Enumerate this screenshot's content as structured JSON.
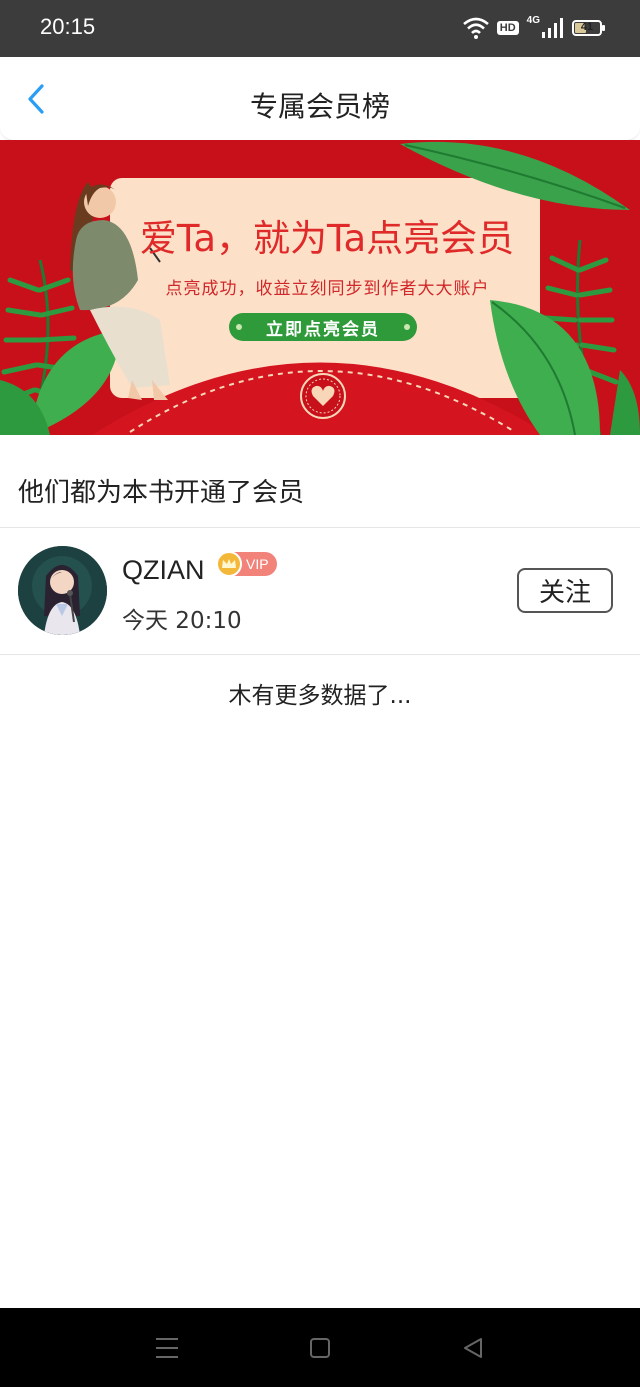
{
  "status_bar": {
    "time": "20:15",
    "hd_label": "HD",
    "network_label": "4G",
    "battery_level": "41",
    "icons": [
      "wifi-icon",
      "hd-icon",
      "signal-icon",
      "battery-icon"
    ]
  },
  "nav": {
    "title": "专属会员榜",
    "back_icon": "chevron-left-icon",
    "accent_color": "#2a9df4"
  },
  "banner": {
    "headline": "爱Ta，就为Ta点亮会员",
    "subline": "点亮成功，收益立刻同步到作者大大账户",
    "cta_label": "立即点亮会员",
    "background_color": "#c8101b",
    "card_color": "#fde0c8"
  },
  "section": {
    "title": "他们都为本书开通了会员"
  },
  "members": [
    {
      "name": "QZIAN",
      "badge": "VIP",
      "time": "今天 20:10",
      "follow_label": "关注"
    }
  ],
  "list_footer": "木有更多数据了...",
  "system_nav": {
    "icons": [
      "menu-icon",
      "home-icon",
      "back-triangle-icon"
    ]
  }
}
